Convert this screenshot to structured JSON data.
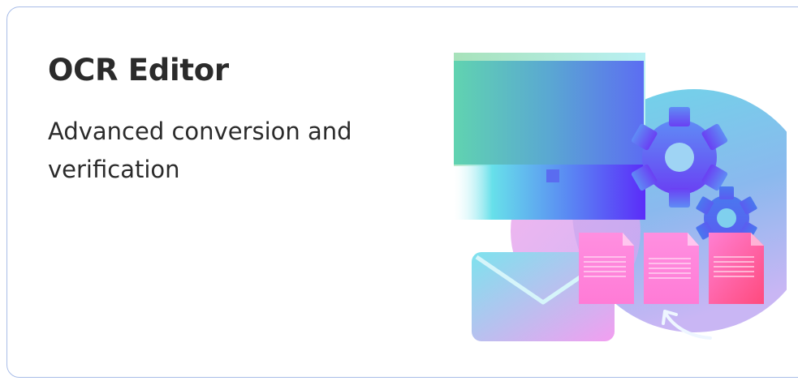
{
  "card": {
    "title": "OCR Editor",
    "description": "Advanced conversion and verification"
  },
  "illustration": {
    "icons": [
      "monitor-icon",
      "gear-icon",
      "small-gear-icon",
      "envelope-icon",
      "document-icon",
      "refresh-arrow-icon"
    ],
    "colors": {
      "teal": "#5fd6c6",
      "blue": "#4f7ff0",
      "violet": "#5a3dfa",
      "pink": "#ff7ad9",
      "rose": "#ff4f86",
      "sky": "#6fc8f0"
    }
  }
}
